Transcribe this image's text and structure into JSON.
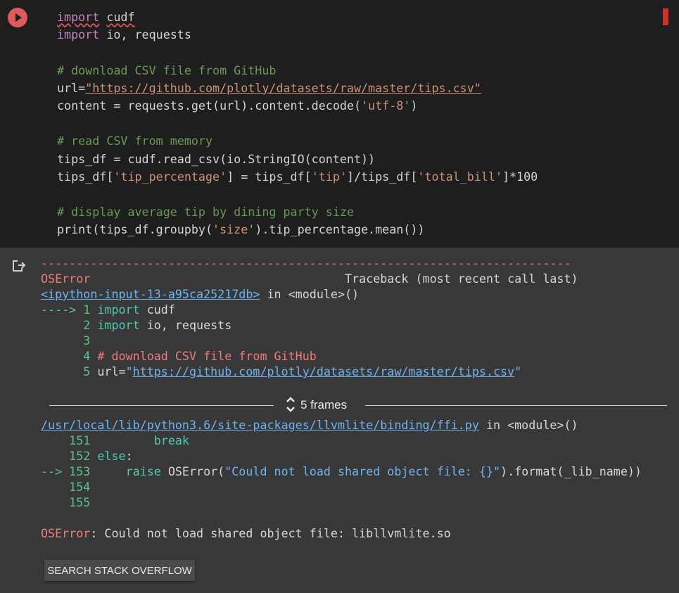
{
  "code": {
    "lines": [
      "import cudf",
      "import io, requests",
      "",
      "# download CSV file from GitHub",
      "url=\"https://github.com/plotly/datasets/raw/master/tips.csv\"",
      "content = requests.get(url).content.decode('utf-8')",
      "",
      "# read CSV from memory",
      "tips_df = cudf.read_csv(io.StringIO(content))",
      "tips_df['tip_percentage'] = tips_df['tip']/tips_df['total_bill']*100",
      "",
      "# display average tip by dining party size",
      "print(tips_df.groupby('size').tip_percentage.mean())"
    ]
  },
  "traceback": {
    "separator": "---------------------------------------------------------------------------",
    "error_name": "OSError",
    "header_right": "Traceback (most recent call last)",
    "frame1": {
      "location": "<ipython-input-13-a95ca25217db>",
      "suffix": " in <module>()",
      "lines": [
        "----> 1 import cudf",
        "      2 import io, requests",
        "      3 ",
        "      4 # download CSV file from GitHub",
        "      5 url=\"https://github.com/plotly/datasets/raw/master/tips.csv\""
      ]
    },
    "frames_toggle": "5 frames",
    "frame2": {
      "location": "/usr/local/lib/python3.6/site-packages/llvmlite/binding/ffi.py",
      "suffix": " in <module>()",
      "lines": [
        "    151         break",
        "    152 else:",
        "--> 153     raise OSError(\"Could not load shared object file: {}\".format(_lib_name))",
        "    154 ",
        "    155 "
      ]
    },
    "final_error": "OSError",
    "final_message": ": Could not load shared object file: libllvmlite.so"
  },
  "search_button": "SEARCH STACK OVERFLOW",
  "icons": {
    "run": "play-icon",
    "output": "output-redirect-icon",
    "frames": "unfold-icon"
  },
  "colors": {
    "run_button": "#e05a5a",
    "error": "#f07a7a",
    "link": "#6fb3f0",
    "line_number": "#5bc28a"
  }
}
